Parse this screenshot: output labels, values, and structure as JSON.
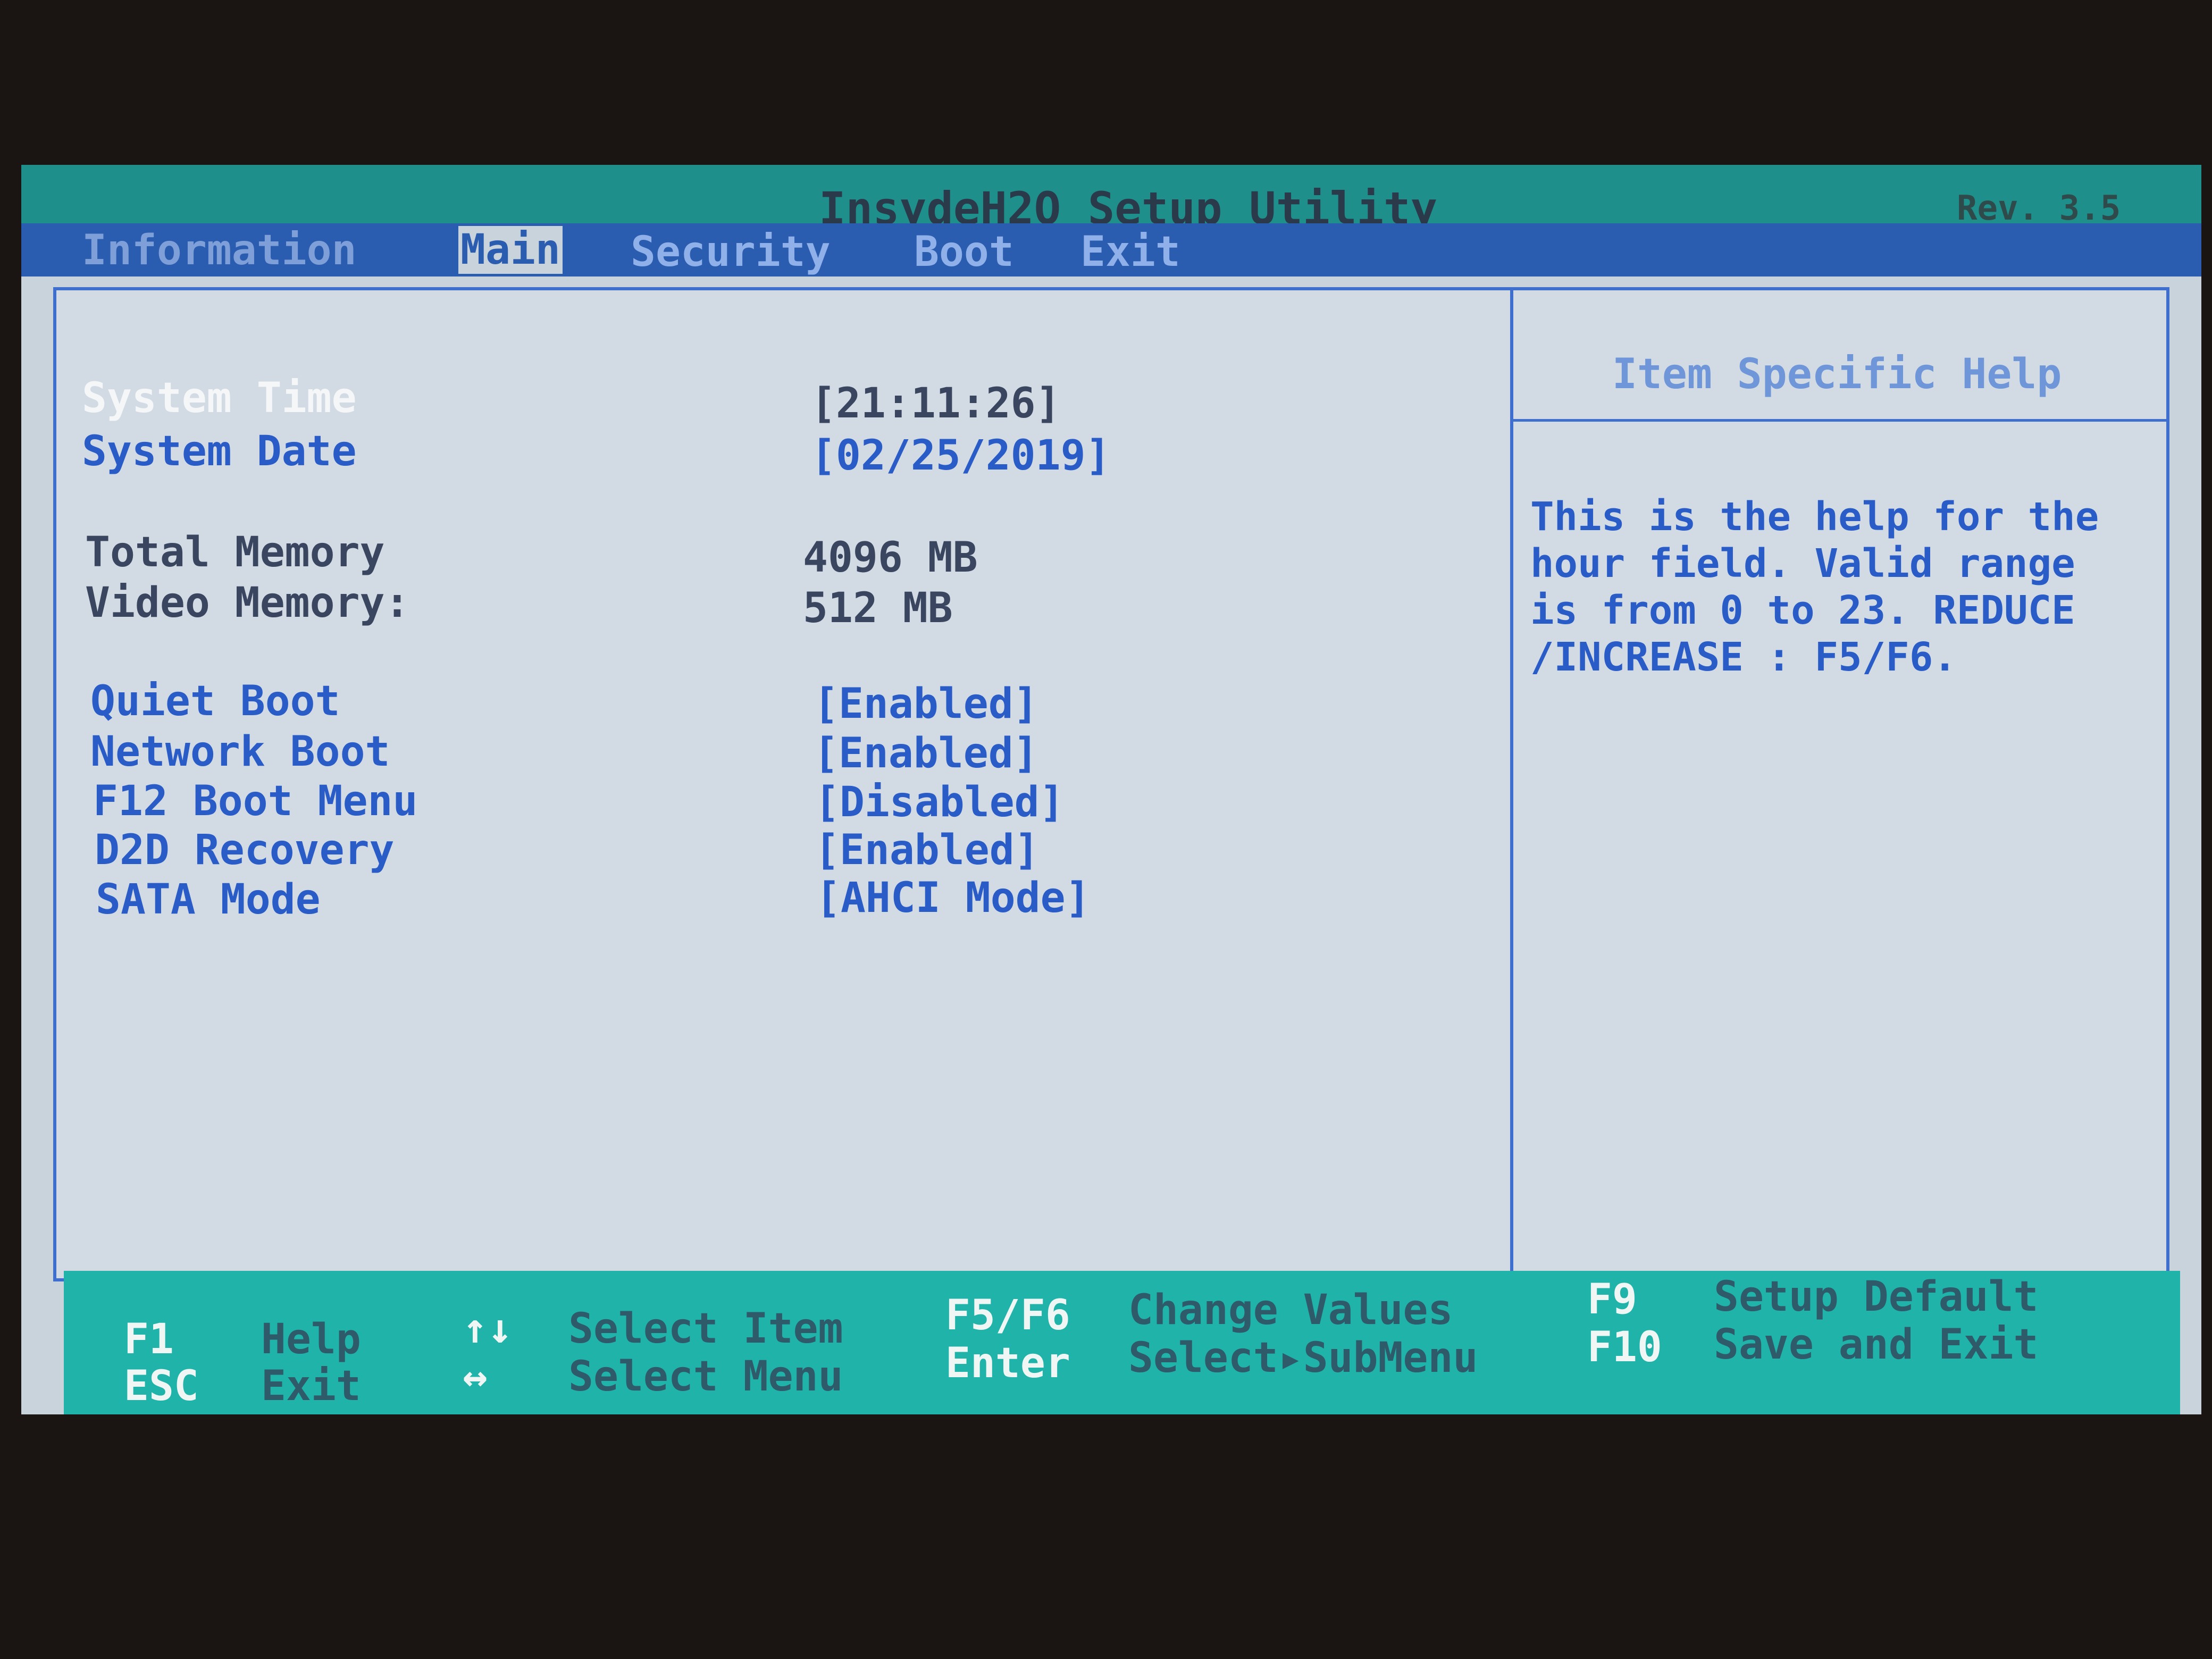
{
  "title": "InsydeH2O Setup Utility",
  "revision": "Rev. 3.5",
  "menu": [
    {
      "label": "Information"
    },
    {
      "label": "Main",
      "selected": true
    },
    {
      "label": "Security"
    },
    {
      "label": "Boot"
    },
    {
      "label": "Exit"
    }
  ],
  "main": {
    "items": [
      {
        "label": "System Time",
        "value": "[21:11:26]",
        "selected": true
      },
      {
        "label": "System Date",
        "value": "[02/25/2019]"
      },
      {
        "label": "Total Memory",
        "value": "4096 MB"
      },
      {
        "label": "Video Memory:",
        "value": "512 MB"
      },
      {
        "label": "Quiet Boot",
        "value": "[Enabled]"
      },
      {
        "label": "Network Boot",
        "value": "[Enabled]"
      },
      {
        "label": "F12 Boot Menu",
        "value": "[Disabled]"
      },
      {
        "label": "D2D Recovery",
        "value": "[Enabled]"
      },
      {
        "label": "SATA Mode",
        "value": "[AHCI Mode]"
      }
    ]
  },
  "help": {
    "title": "Item Specific Help",
    "lines": [
      "This is the help for the",
      "hour field. Valid range",
      "is from 0 to 23. REDUCE",
      "/INCREASE : F5/F6."
    ]
  },
  "footer": [
    {
      "key": "F1",
      "desc": "Help"
    },
    {
      "key": "ESC",
      "desc": "Exit"
    },
    {
      "key": "↑↓",
      "desc": "Select Item"
    },
    {
      "key": "↔",
      "desc": "Select Menu"
    },
    {
      "key": "F5/F6",
      "desc": "Change Values"
    },
    {
      "key": "Enter",
      "desc": "Select▸SubMenu"
    },
    {
      "key": "F9",
      "desc": "Setup Default"
    },
    {
      "key": "F10",
      "desc": "Save and Exit"
    }
  ],
  "colors": {
    "title_bar": "#1f8f8c",
    "menu_bar": "#2a5cb0",
    "panel": "#d2dbe3",
    "footer": "#1fb3aa",
    "accent": "#2a5cc8"
  }
}
